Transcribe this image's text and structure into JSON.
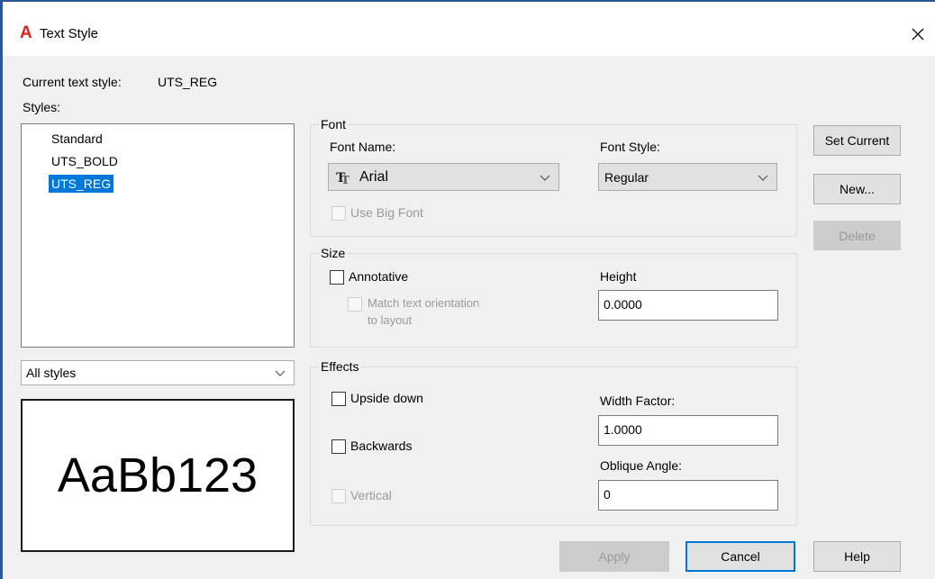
{
  "window": {
    "title": "Text Style",
    "app_icon_glyph": "A",
    "brand_color": "#e1201d"
  },
  "current": {
    "label": "Current text style:",
    "value": "UTS_REG"
  },
  "styles": {
    "label": "Styles:",
    "items": [
      "Standard",
      "UTS_BOLD",
      "UTS_REG"
    ],
    "selected": "UTS_REG",
    "filter_value": "All styles"
  },
  "preview": {
    "sample": "AaBb123"
  },
  "font": {
    "group_label": "Font",
    "name_label": "Font Name:",
    "name_value": "Arial",
    "name_icon": "truetype-font-icon",
    "style_label": "Font Style:",
    "style_value": "Regular",
    "big_font_label": "Use Big Font"
  },
  "size": {
    "group_label": "Size",
    "annotative_label": "Annotative",
    "match_line1": "Match text orientation",
    "match_line2": "to layout",
    "height_label": "Height",
    "height_value": "0.0000"
  },
  "effects": {
    "group_label": "Effects",
    "upside_down_label": "Upside down",
    "backwards_label": "Backwards",
    "vertical_label": "Vertical",
    "width_factor_label": "Width Factor:",
    "width_factor_value": "1.0000",
    "oblique_label": "Oblique Angle:",
    "oblique_value": "0"
  },
  "buttons": {
    "set_current": "Set Current",
    "new": "New...",
    "delete": "Delete",
    "apply": "Apply",
    "cancel": "Cancel",
    "help": "Help"
  },
  "colors": {
    "selection": "#0078d7",
    "frame": "#2b5797"
  }
}
